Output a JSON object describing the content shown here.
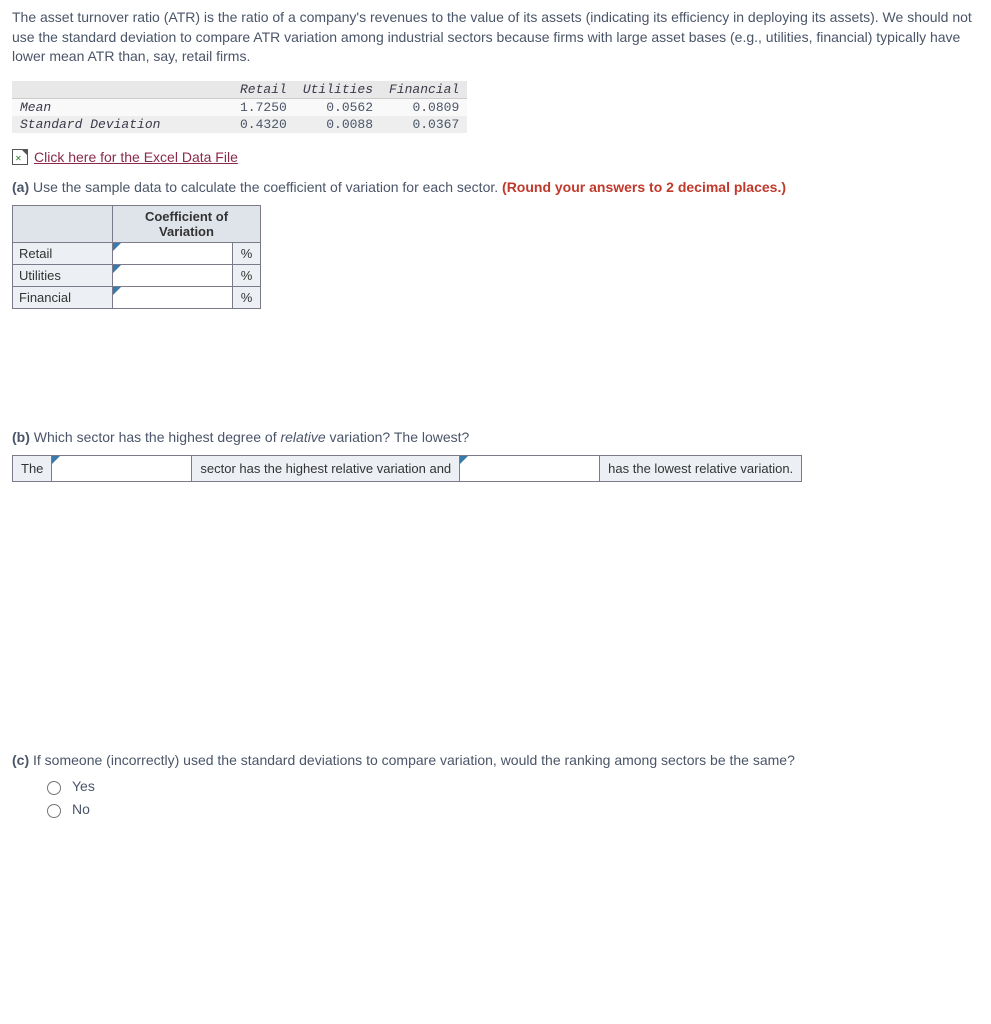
{
  "intro": "The asset turnover ratio (ATR) is the ratio of a company's revenues to the value of its assets (indicating its efficiency in deploying its assets). We should not use the standard deviation to compare ATR variation among industrial sectors because firms with large asset bases (e.g., utilities, financial) typically have lower mean ATR than, say, retail firms.",
  "data_table": {
    "columns": [
      "Retail",
      "Utilities",
      "Financial"
    ],
    "rows": [
      {
        "label": "Mean",
        "values": [
          "1.7250",
          "0.0562",
          "0.0809"
        ]
      },
      {
        "label": "Standard Deviation",
        "values": [
          "0.4320",
          "0.0088",
          "0.0367"
        ]
      }
    ]
  },
  "excel_link": " Click here for the Excel Data File",
  "part_a": {
    "label": "(a)",
    "text": " Use the sample data to calculate the coefficient of variation for each sector. ",
    "instruction": "(Round your answers to 2 decimal places.)",
    "header": "Coefficient of Variation",
    "rows": [
      "Retail",
      "Utilities",
      "Financial"
    ],
    "unit": "%"
  },
  "part_b": {
    "label": "(b)",
    "text_before_italic": " Which sector has the highest degree of ",
    "italic_word": "relative",
    "text_after_italic": " variation? The lowest?",
    "sentence": {
      "lead": "The",
      "mid": "sector has the highest relative variation and",
      "tail": "has the lowest relative variation."
    }
  },
  "part_c": {
    "label": "(c)",
    "text": " If someone (incorrectly) used the standard deviations to compare variation, would the ranking among sectors be the same?",
    "options": [
      "Yes",
      "No"
    ]
  }
}
